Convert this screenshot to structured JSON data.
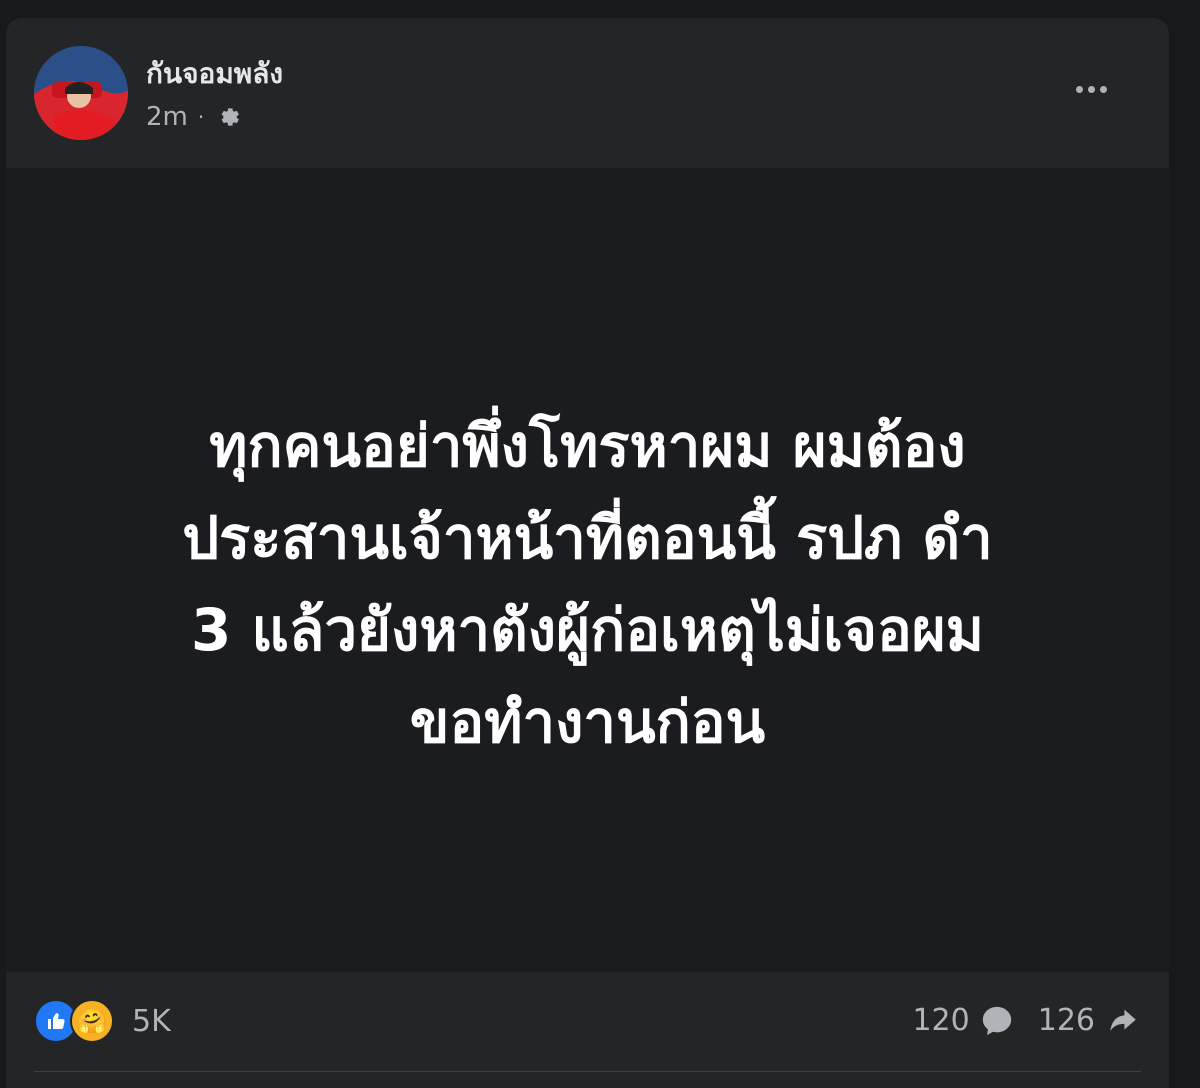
{
  "post": {
    "author": "กันจอมพลัง",
    "time": "2m",
    "text": "ทุกคนอย่าพึ่งโทรหาผม ผมต้อง\nประสานเจ้าหน้าที่ตอนนี้ รปภ ดำ\n3 แล้วยังหาตังผู้ก่อเหตุไม่เจอผม\nขอทำงานก่อน"
  },
  "stats": {
    "reactions": "5K",
    "comments": "120",
    "shares": "126"
  },
  "colors": {
    "background": "#18191a",
    "card": "#242526",
    "content": "#1b1c1f",
    "accent": "#2078f4"
  }
}
